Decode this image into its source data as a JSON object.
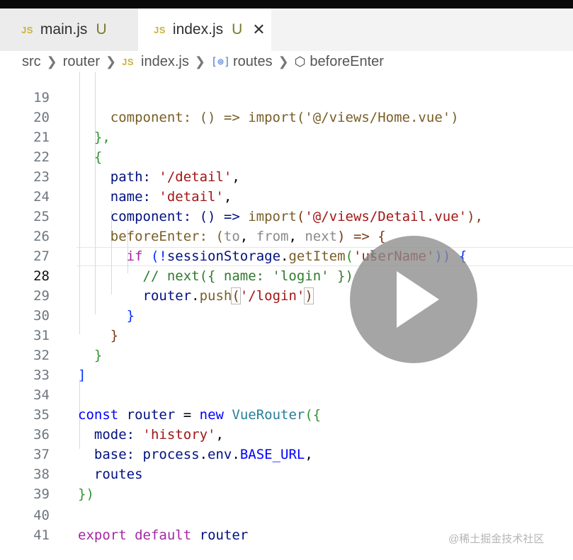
{
  "tabs": [
    {
      "icon": "JS",
      "name": "main.js",
      "status": "U"
    },
    {
      "icon": "JS",
      "name": "index.js",
      "status": "U",
      "close": "✕"
    }
  ],
  "breadcrumb": {
    "folder1": "src",
    "folder2": "router",
    "file_icon": "JS",
    "file": "index.js",
    "symbol_icon": "[⊚]",
    "symbol": "routes",
    "method": "beforeEnter"
  },
  "lines": [
    {
      "n": "19",
      "t": [
        "    component: () => import('@/views/Home.vue')"
      ]
    },
    {
      "n": "20",
      "t": [
        "  },"
      ]
    },
    {
      "n": "21",
      "t": [
        "  {"
      ]
    },
    {
      "n": "22",
      "t": [
        "    path: ",
        "'/detail'",
        ","
      ]
    },
    {
      "n": "23",
      "t": [
        "    name: ",
        "'detail'",
        ","
      ]
    },
    {
      "n": "24",
      "t": [
        "    component: () => ",
        "import",
        "(",
        "'@/views/Detail.vue'",
        "),"
      ]
    },
    {
      "n": "25",
      "t": [
        "    beforeEnter: (",
        "to",
        ", ",
        "from",
        ", ",
        "next",
        ") => {"
      ]
    },
    {
      "n": "26",
      "t": [
        "      ",
        "if",
        " (!",
        "sessionStorage",
        ".",
        "getItem",
        "(",
        "'userName'",
        ")) {"
      ]
    },
    {
      "n": "27",
      "t": [
        "        // next({ name: 'login' })"
      ]
    },
    {
      "n": "28",
      "t": [
        "        ",
        "router",
        ".",
        "push",
        "(",
        "'/login'",
        ")"
      ]
    },
    {
      "n": "29",
      "t": [
        "      }"
      ]
    },
    {
      "n": "30",
      "t": [
        "    }"
      ]
    },
    {
      "n": "31",
      "t": [
        "  }"
      ]
    },
    {
      "n": "32",
      "t": [
        "]"
      ]
    },
    {
      "n": "33",
      "t": [
        ""
      ]
    },
    {
      "n": "34",
      "t": [
        "const",
        " ",
        "router",
        " = ",
        "new",
        " ",
        "VueRouter",
        "({"
      ]
    },
    {
      "n": "35",
      "t": [
        "  mode: ",
        "'history'",
        ","
      ]
    },
    {
      "n": "36",
      "t": [
        "  base: ",
        "process",
        ".",
        "env",
        ".",
        "BASE_URL",
        ","
      ]
    },
    {
      "n": "37",
      "t": [
        "  routes"
      ]
    },
    {
      "n": "38",
      "t": [
        "})"
      ]
    },
    {
      "n": "39",
      "t": [
        ""
      ]
    },
    {
      "n": "40",
      "t": [
        "export",
        " ",
        "default",
        " ",
        "router"
      ]
    },
    {
      "n": "41",
      "t": [
        ""
      ]
    }
  ],
  "cursor_glyph": "I",
  "watermark": "@稀土掘金技术社区",
  "icons": {
    "play": "play-icon",
    "js": "js-file-icon",
    "close": "close-icon",
    "symbol": "variable-symbol-icon",
    "method": "method-cube-icon"
  },
  "colors": {
    "keyword": "#a626a4",
    "string": "#a31515",
    "property": "#001080",
    "function": "#795e26",
    "class": "#267f99",
    "comment": "#2f7a2f"
  }
}
